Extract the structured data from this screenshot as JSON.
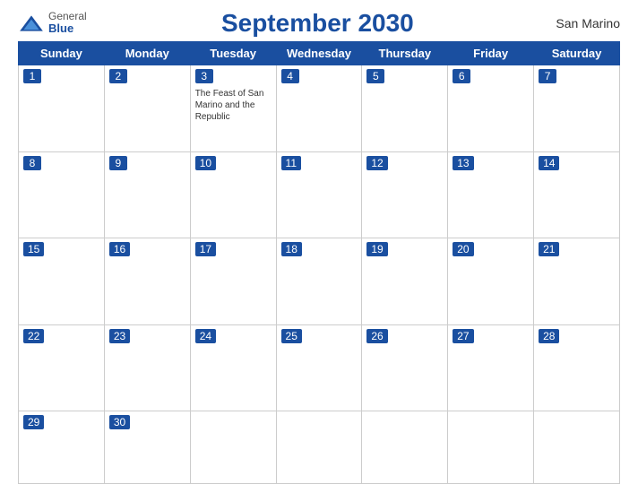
{
  "header": {
    "title": "September 2030",
    "country": "San Marino",
    "logo_general": "General",
    "logo_blue": "Blue"
  },
  "days_of_week": [
    "Sunday",
    "Monday",
    "Tuesday",
    "Wednesday",
    "Thursday",
    "Friday",
    "Saturday"
  ],
  "weeks": [
    [
      {
        "num": "1",
        "events": []
      },
      {
        "num": "2",
        "events": []
      },
      {
        "num": "3",
        "events": [
          {
            "text": "The Feast of San Marino and the Republic"
          }
        ]
      },
      {
        "num": "4",
        "events": []
      },
      {
        "num": "5",
        "events": []
      },
      {
        "num": "6",
        "events": []
      },
      {
        "num": "7",
        "events": []
      }
    ],
    [
      {
        "num": "8",
        "events": []
      },
      {
        "num": "9",
        "events": []
      },
      {
        "num": "10",
        "events": []
      },
      {
        "num": "11",
        "events": []
      },
      {
        "num": "12",
        "events": []
      },
      {
        "num": "13",
        "events": []
      },
      {
        "num": "14",
        "events": []
      }
    ],
    [
      {
        "num": "15",
        "events": []
      },
      {
        "num": "16",
        "events": []
      },
      {
        "num": "17",
        "events": []
      },
      {
        "num": "18",
        "events": []
      },
      {
        "num": "19",
        "events": []
      },
      {
        "num": "20",
        "events": []
      },
      {
        "num": "21",
        "events": []
      }
    ],
    [
      {
        "num": "22",
        "events": []
      },
      {
        "num": "23",
        "events": []
      },
      {
        "num": "24",
        "events": []
      },
      {
        "num": "25",
        "events": []
      },
      {
        "num": "26",
        "events": []
      },
      {
        "num": "27",
        "events": []
      },
      {
        "num": "28",
        "events": []
      }
    ],
    [
      {
        "num": "29",
        "events": []
      },
      {
        "num": "30",
        "events": []
      },
      {
        "num": "",
        "events": []
      },
      {
        "num": "",
        "events": []
      },
      {
        "num": "",
        "events": []
      },
      {
        "num": "",
        "events": []
      },
      {
        "num": "",
        "events": []
      }
    ]
  ]
}
